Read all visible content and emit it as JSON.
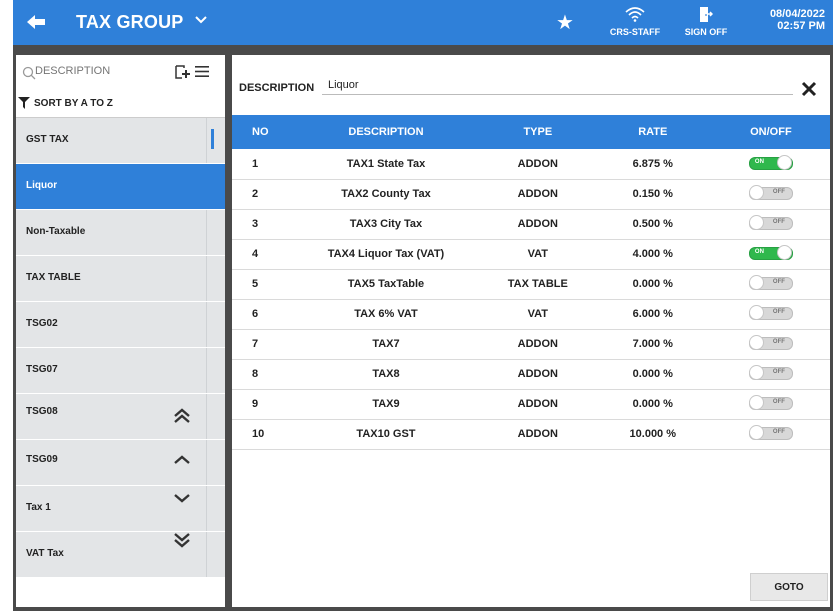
{
  "header": {
    "title": "TAX GROUP",
    "wifi_label": "CRS-STAFF",
    "signoff_label": "SIGN OFF",
    "date": "08/04/2022",
    "time": "02:57 PM",
    "accent_color": "#2f80d9"
  },
  "sidebar": {
    "search_placeholder": "DESCRIPTION",
    "sort_label": "SORT BY A TO Z",
    "items": [
      {
        "label": "GST TAX",
        "active": false
      },
      {
        "label": "Liquor",
        "active": true
      },
      {
        "label": "Non-Taxable",
        "active": false
      },
      {
        "label": "TAX TABLE",
        "active": false
      },
      {
        "label": "TSG02",
        "active": false
      },
      {
        "label": "TSG07",
        "active": false
      },
      {
        "label": "TSG08",
        "active": false
      },
      {
        "label": "TSG09",
        "active": false
      },
      {
        "label": "Tax 1",
        "active": false
      },
      {
        "label": "VAT Tax",
        "active": false
      }
    ]
  },
  "detail": {
    "description_label": "DESCRIPTION",
    "description_value": "Liquor",
    "columns": [
      "NO",
      "DESCRIPTION",
      "TYPE",
      "RATE",
      "ON/OFF"
    ],
    "rows": [
      {
        "no": "1",
        "description": "TAX1 State Tax",
        "type": "ADDON",
        "rate": "6.875 %",
        "on": true
      },
      {
        "no": "2",
        "description": "TAX2 County Tax",
        "type": "ADDON",
        "rate": "0.150 %",
        "on": false
      },
      {
        "no": "3",
        "description": "TAX3 City Tax",
        "type": "ADDON",
        "rate": "0.500 %",
        "on": false
      },
      {
        "no": "4",
        "description": "TAX4 Liquor Tax (VAT)",
        "type": "VAT",
        "rate": "4.000 %",
        "on": true
      },
      {
        "no": "5",
        "description": "TAX5 TaxTable",
        "type": "TAX TABLE",
        "rate": "0.000 %",
        "on": false
      },
      {
        "no": "6",
        "description": "TAX 6% VAT",
        "type": "VAT",
        "rate": "6.000 %",
        "on": false
      },
      {
        "no": "7",
        "description": "TAX7",
        "type": "ADDON",
        "rate": "7.000 %",
        "on": false
      },
      {
        "no": "8",
        "description": "TAX8",
        "type": "ADDON",
        "rate": "0.000 %",
        "on": false
      },
      {
        "no": "9",
        "description": "TAX9",
        "type": "ADDON",
        "rate": "0.000 %",
        "on": false
      },
      {
        "no": "10",
        "description": "TAX10 GST",
        "type": "ADDON",
        "rate": "10.000 %",
        "on": false
      }
    ],
    "toggle_on_text": "ON",
    "toggle_off_text": "OFF",
    "goto_label": "GOTO"
  },
  "icons": {
    "back": "arrow-left-icon",
    "title_dropdown": "chevron-down-icon",
    "favorite": "star-icon",
    "wifi": "wifi-icon",
    "signoff": "exit-door-icon",
    "search": "search-icon",
    "add": "add-document-icon",
    "menu": "hamburger-icon",
    "sort": "funnel-icon",
    "scroll_top": "double-chevron-up-icon",
    "scroll_up": "chevron-up-icon",
    "scroll_down": "chevron-down-icon",
    "scroll_bottom": "double-chevron-down-icon",
    "close": "close-icon"
  }
}
